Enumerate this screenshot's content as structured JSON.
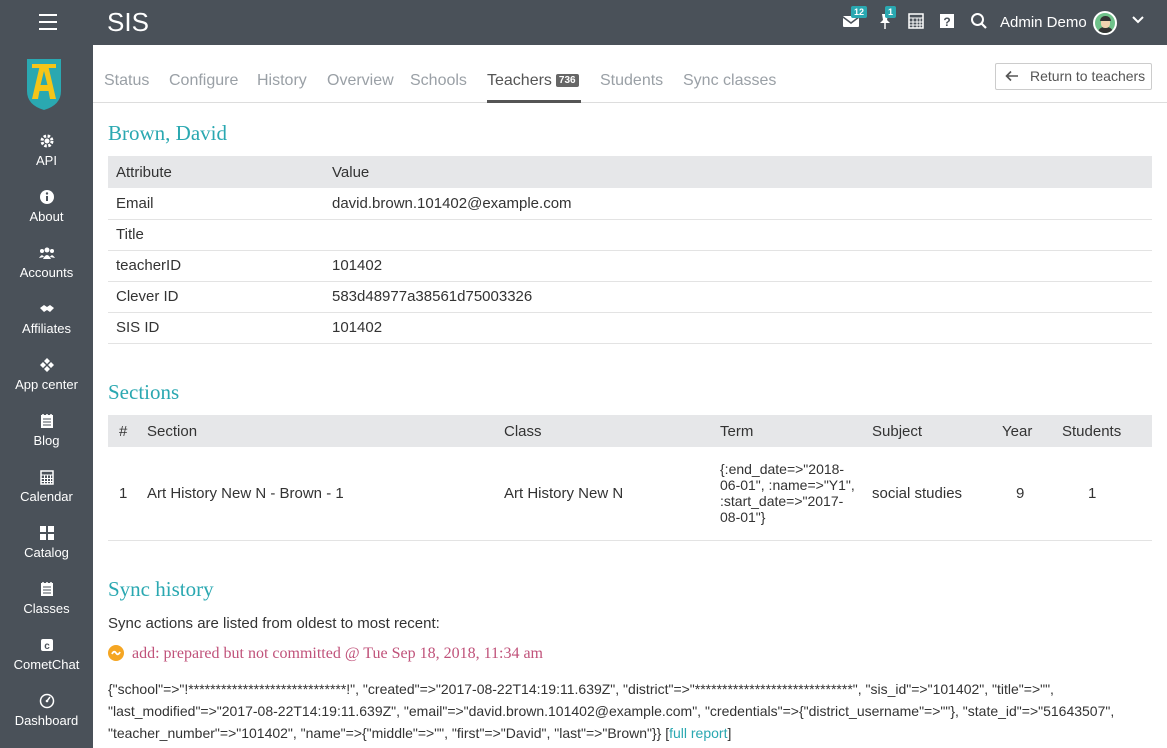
{
  "app": {
    "title": "SIS"
  },
  "header": {
    "notifications": [
      {
        "name": "mail",
        "count": "12"
      },
      {
        "name": "pin",
        "count": "1"
      }
    ],
    "user_name": "Admin Demo"
  },
  "sidebar": {
    "items": [
      {
        "label": "API",
        "icon": "gear-icon"
      },
      {
        "label": "About",
        "icon": "info-icon"
      },
      {
        "label": "Accounts",
        "icon": "users-icon"
      },
      {
        "label": "Affiliates",
        "icon": "handshake-icon"
      },
      {
        "label": "App center",
        "icon": "diamond-icon"
      },
      {
        "label": "Blog",
        "icon": "notebook-icon"
      },
      {
        "label": "Calendar",
        "icon": "calendar-icon"
      },
      {
        "label": "Catalog",
        "icon": "grid-icon"
      },
      {
        "label": "Classes",
        "icon": "notebook-icon"
      },
      {
        "label": "CometChat",
        "icon": "chat-icon"
      },
      {
        "label": "Dashboard",
        "icon": "gauge-icon"
      }
    ]
  },
  "tabs": [
    {
      "label": "Status"
    },
    {
      "label": "Configure"
    },
    {
      "label": "History"
    },
    {
      "label": "Overview"
    },
    {
      "label": "Schools"
    },
    {
      "label": "Teachers",
      "badge": "736",
      "active": true
    },
    {
      "label": "Students"
    },
    {
      "label": "Sync classes"
    }
  ],
  "return_button": "Return to teachers",
  "teacher": {
    "name": "Brown, David",
    "table_headers": {
      "attribute": "Attribute",
      "value": "Value"
    },
    "rows": [
      {
        "attribute": "Email",
        "value": "david.brown.101402@example.com"
      },
      {
        "attribute": "Title",
        "value": ""
      },
      {
        "attribute": "teacherID",
        "value": "101402"
      },
      {
        "attribute": "Clever ID",
        "value": "583d48977a38561d75003326"
      },
      {
        "attribute": "SIS ID",
        "value": "101402"
      }
    ]
  },
  "sections": {
    "title": "Sections",
    "headers": {
      "num": "#",
      "section": "Section",
      "class": "Class",
      "term": "Term",
      "subject": "Subject",
      "year": "Year",
      "students": "Students"
    },
    "rows": [
      {
        "num": "1",
        "section": "Art History New N - Brown - 1",
        "class": "Art History New N",
        "term": "{:end_date=>\"2018-06-01\", :name=>\"Y1\", :start_date=>\"2017-08-01\"}",
        "subject": "social studies",
        "year": "9",
        "students": "1"
      }
    ]
  },
  "sync": {
    "title": "Sync history",
    "intro": "Sync actions are listed from oldest to most recent:",
    "action": "add: prepared but not committed @ Tue Sep 18, 2018, 11:34 am",
    "json": "{\"school\"=>\"!*****************************!\", \"created\"=>\"2017-08-22T14:19:11.639Z\", \"district\"=>\"*****************************\", \"sis_id\"=>\"101402\", \"title\"=>\"\", \"last_modified\"=>\"2017-08-22T14:19:11.639Z\", \"email\"=>\"david.brown.101402@example.com\", \"credentials\"=>{\"district_username\"=>\"\"}, \"state_id\"=>\"51643507\", \"teacher_number\"=>\"101402\", \"name\"=>{\"middle\"=>\"\", \"first\"=>\"David\", \"last\"=>\"Brown\"}}",
    "report_link": "full report"
  },
  "colors": {
    "accent": "#2aa8b1",
    "sidebar": "#4a5159",
    "action": "#c0527a"
  }
}
